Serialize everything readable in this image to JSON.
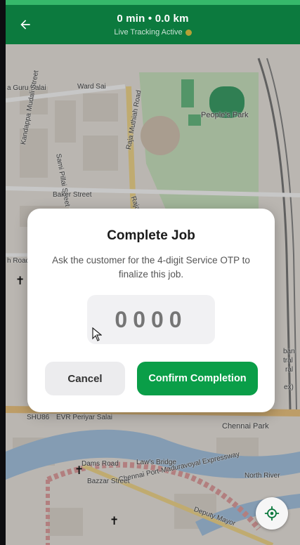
{
  "header": {
    "title": "0 min • 0.0 km",
    "subtitle": "Live Tracking Active",
    "back_icon": "arrow-left-icon"
  },
  "map": {
    "labels": {
      "guru_salai": "a Guru Salai",
      "ward_sai": "Ward Sai",
      "kandappa": "Kandappa Mudali Street",
      "sami_pillai": "Sami Pillai Street",
      "raja_muthiah": "Raja Muthiah Road",
      "peoples_park": "People's Park",
      "baker_street": "Baker Street",
      "raja_short": "Raja",
      "h_road": "h Road",
      "shu86": "SHU86",
      "evr": "EVR Periyar Salai",
      "chennai_park": "Chennai Park",
      "laws_bridge": "Law's Bridge",
      "dams_road": "Dams Road",
      "chennai_port": "Chennai Port-Maduravoyal Expressway",
      "bazzar": "Bazzar Street",
      "north_river": "North River",
      "deputy_mayor": "Deputy Mayor",
      "right_ban": "ban",
      "right_tral": "tral",
      "right_ral": "ral",
      "right_ex": "ex)"
    },
    "locate_icon": "crosshair-icon",
    "colors": {
      "park": "#cfe8c4",
      "water": "#a9c8e6",
      "pitch": "#3ea36b",
      "road_major": "#f6dc90"
    }
  },
  "modal": {
    "title": "Complete Job",
    "description": "Ask the customer for the 4-digit Service OTP to finalize this job.",
    "otp_placeholder": "0000",
    "cancel_label": "Cancel",
    "confirm_label": "Confirm Completion"
  },
  "colors": {
    "header": "#0c7a3e",
    "status_strip": "#36b86a",
    "confirm": "#0a9e48",
    "live_dot": "#b5a135"
  }
}
